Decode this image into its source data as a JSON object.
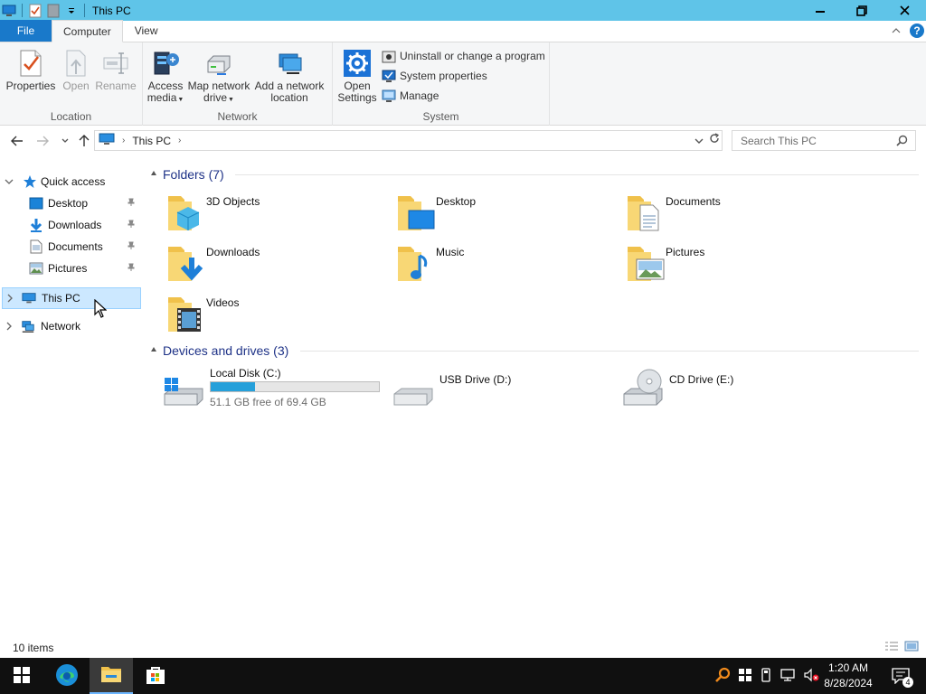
{
  "window": {
    "title": "This PC"
  },
  "ribbon": {
    "tabs": [
      {
        "label": "File"
      },
      {
        "label": "Computer"
      },
      {
        "label": "View"
      }
    ],
    "groups": {
      "location": {
        "label": "Location",
        "buttons": [
          {
            "label": "Properties",
            "icon": "properties-icon"
          },
          {
            "label": "Open",
            "icon": "open-icon"
          },
          {
            "label": "Rename",
            "icon": "rename-icon"
          }
        ]
      },
      "network": {
        "label": "Network",
        "buttons": [
          {
            "line1": "Access",
            "line2": "media",
            "icon": "access-media-icon"
          },
          {
            "line1": "Map network",
            "line2": "drive",
            "icon": "map-network-drive-icon"
          },
          {
            "line1": "Add a network",
            "line2": "location",
            "icon": "add-network-location-icon"
          }
        ]
      },
      "system": {
        "label": "System",
        "open_settings": {
          "line1": "Open",
          "line2": "Settings"
        },
        "small": [
          {
            "label": "Uninstall or change a program",
            "icon": "uninstall-icon"
          },
          {
            "label": "System properties",
            "icon": "system-properties-icon"
          },
          {
            "label": "Manage",
            "icon": "manage-icon"
          }
        ]
      }
    }
  },
  "address": {
    "path": "This PC",
    "search_placeholder": "Search This PC"
  },
  "nav": {
    "quick_access": "Quick access",
    "items": [
      {
        "label": "Desktop",
        "icon": "desktop-icon"
      },
      {
        "label": "Downloads",
        "icon": "downloads-icon"
      },
      {
        "label": "Documents",
        "icon": "documents-icon"
      },
      {
        "label": "Pictures",
        "icon": "pictures-icon"
      }
    ],
    "this_pc": "This PC",
    "network": "Network"
  },
  "content": {
    "folders_header": "Folders (7)",
    "folders": [
      {
        "label": "3D Objects",
        "icon": "3d-objects-icon"
      },
      {
        "label": "Desktop",
        "icon": "desktop-folder-icon"
      },
      {
        "label": "Documents",
        "icon": "documents-folder-icon"
      },
      {
        "label": "Downloads",
        "icon": "downloads-folder-icon"
      },
      {
        "label": "Music",
        "icon": "music-folder-icon"
      },
      {
        "label": "Pictures",
        "icon": "pictures-folder-icon"
      },
      {
        "label": "Videos",
        "icon": "videos-folder-icon"
      }
    ],
    "drives_header": "Devices and drives (3)",
    "drives": [
      {
        "label": "Local Disk (C:)",
        "free": "51.1 GB free of 69.4 GB",
        "used_fraction": 0.264,
        "icon": "local-disk-icon"
      },
      {
        "label": "USB Drive (D:)",
        "icon": "usb-drive-icon"
      },
      {
        "label": "CD Drive (E:)",
        "icon": "cd-drive-icon"
      }
    ]
  },
  "status": {
    "count": "10 items"
  },
  "taskbar": {
    "time": "1:20 AM",
    "date": "8/28/2024",
    "notification_count": "4"
  },
  "colors": {
    "titlebar": "#5fc4e8",
    "file_tab": "#1979ca",
    "accent": "#26a0da",
    "section_header": "#1e3287",
    "taskbar": "#101010"
  }
}
